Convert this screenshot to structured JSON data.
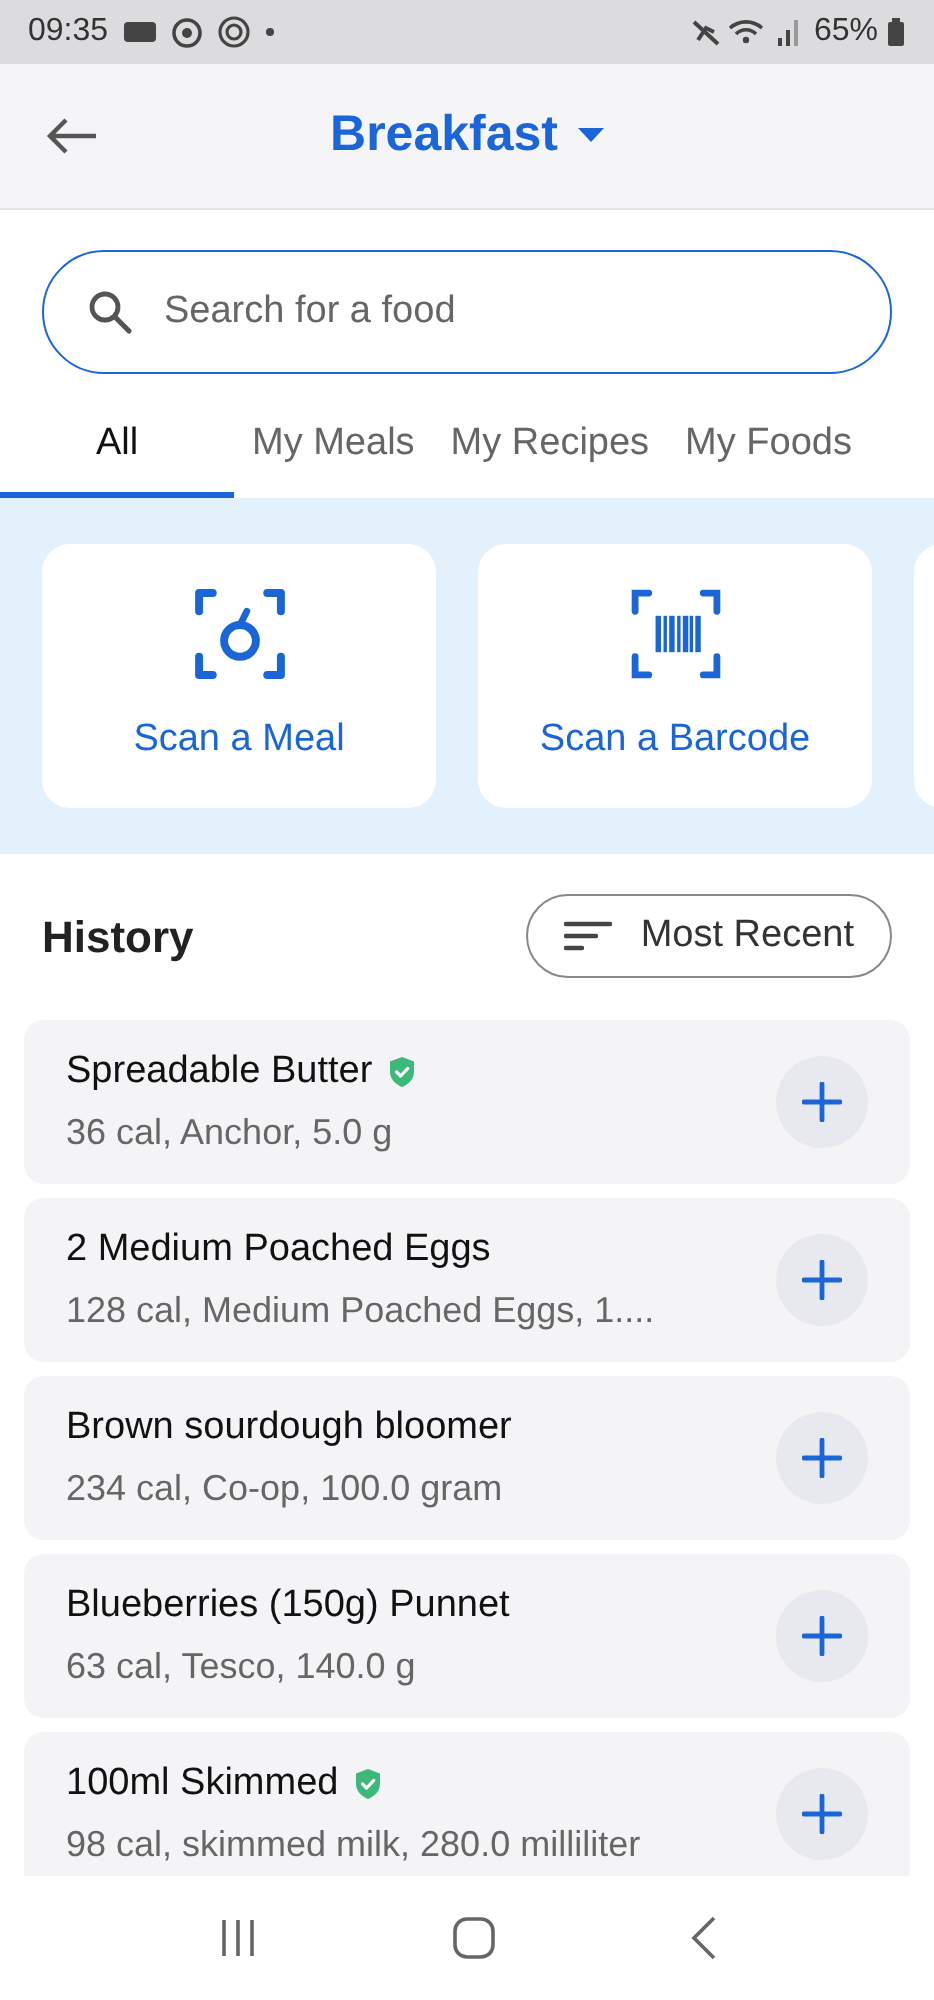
{
  "status_bar": {
    "time": "09:35",
    "battery": "65%"
  },
  "header": {
    "title": "Breakfast"
  },
  "search": {
    "placeholder": "Search for a food"
  },
  "tabs": [
    {
      "label": "All",
      "selected": true
    },
    {
      "label": "My Meals",
      "selected": false
    },
    {
      "label": "My Recipes",
      "selected": false
    },
    {
      "label": "My Foods",
      "selected": false
    }
  ],
  "scan_cards": [
    {
      "kind": "meal",
      "label": "Scan a Meal"
    },
    {
      "kind": "barcode",
      "label": "Scan a Barcode"
    }
  ],
  "history": {
    "title": "History",
    "sort": "Most Recent",
    "items": [
      {
        "name": "Spreadable Butter",
        "verified": true,
        "details": "36 cal, Anchor, 5.0 g"
      },
      {
        "name": "2 Medium Poached Eggs",
        "verified": false,
        "details": "128 cal, Medium Poached Eggs, 1...."
      },
      {
        "name": "Brown sourdough bloomer",
        "verified": false,
        "details": "234 cal, Co-op, 100.0 gram"
      },
      {
        "name": "Blueberries (150g) Punnet",
        "verified": false,
        "details": "63 cal, Tesco, 140.0 g"
      },
      {
        "name": "100ml Skimmed",
        "verified": true,
        "details": "98 cal, skimmed milk, 280.0 milliliter"
      }
    ]
  }
}
